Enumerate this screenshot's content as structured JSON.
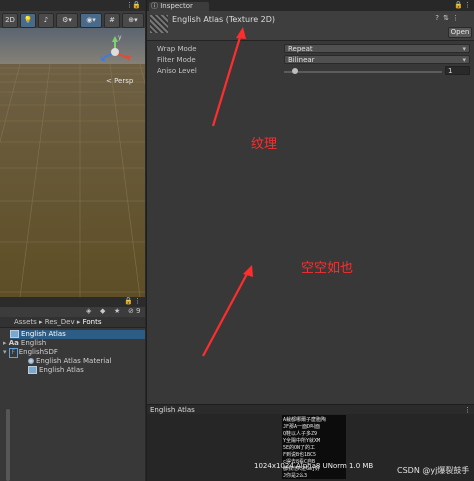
{
  "scene": {
    "toolbar": {
      "btn_2d": "2D",
      "persp_label": "< Persp"
    },
    "gizmo_axes": {
      "y": "y",
      "x": "x",
      "z": "z"
    }
  },
  "project": {
    "search_count": "9",
    "breadcrumb": [
      "Assets",
      "Res_Dev",
      "Fonts"
    ],
    "items": [
      {
        "label": "English Atlas",
        "icon": "texture-icon",
        "selected": true
      },
      {
        "label": "English",
        "icon": "font-icon",
        "prefix": "Aa"
      },
      {
        "label": "EnglishSDF",
        "icon": "textmeshpro-icon",
        "prefix": "F"
      },
      {
        "label": "English Atlas Material",
        "icon": "material-icon"
      },
      {
        "label": "English Atlas",
        "icon": "texture-icon"
      }
    ]
  },
  "inspector": {
    "tab_label": "Inspector",
    "asset_title": "English Atlas (Texture 2D)",
    "open_button": "Open",
    "properties": [
      {
        "label": "Wrap Mode",
        "value": "Repeat"
      },
      {
        "label": "Filter Mode",
        "value": "Bilinear"
      }
    ],
    "aniso": {
      "label": "Aniso Level",
      "value": "1",
      "level": 0
    }
  },
  "preview": {
    "title": "English Atlas",
    "info": "1024x1024 Alpha8 UNorm  1.0 MB"
  },
  "annotations": {
    "texture_note": "纹理",
    "empty_note": "空空如也"
  },
  "watermark": "CSDN @yj爆裂鼓手",
  "colors": {
    "selection": "#2c5d87",
    "annotation": "#ff2d2d",
    "ground": "#6b5a32"
  }
}
